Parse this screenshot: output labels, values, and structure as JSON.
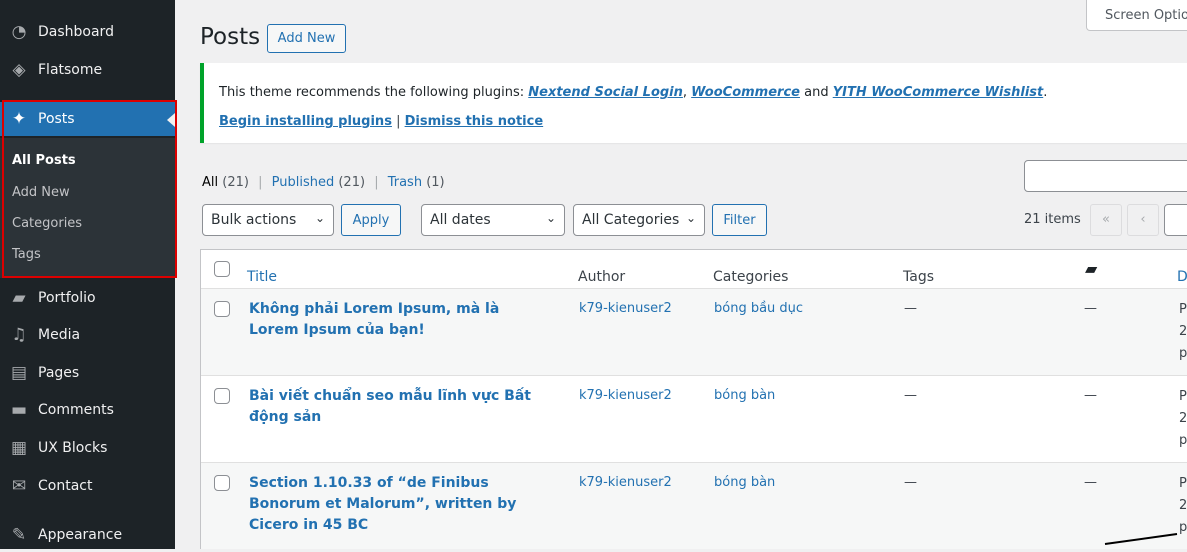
{
  "sidebar": {
    "items": [
      {
        "label": "Dashboard",
        "icon": "dashboard-icon",
        "glyph": "◔"
      },
      {
        "label": "Flatsome",
        "icon": "flatsome-icon",
        "glyph": "◈"
      },
      {
        "label": "Posts",
        "icon": "pin-icon",
        "glyph": "📌"
      },
      {
        "label": "Portfolio",
        "icon": "folder-icon",
        "glyph": "▰"
      },
      {
        "label": "Media",
        "icon": "media-icon",
        "glyph": "♫"
      },
      {
        "label": "Pages",
        "icon": "pages-icon",
        "glyph": "▤"
      },
      {
        "label": "Comments",
        "icon": "comment-icon",
        "glyph": "▬"
      },
      {
        "label": "UX Blocks",
        "icon": "blocks-icon",
        "glyph": "▦"
      },
      {
        "label": "Contact",
        "icon": "mail-icon",
        "glyph": "✉"
      },
      {
        "label": "Appearance",
        "icon": "brush-icon",
        "glyph": "✎"
      }
    ],
    "submenu": [
      "All Posts",
      "Add New",
      "Categories",
      "Tags"
    ]
  },
  "header": {
    "title": "Posts",
    "add_new": "Add New",
    "screen_options": "Screen Optio"
  },
  "notice": {
    "text": "This theme recommends the following plugins: ",
    "p1": "Nextend Social Login",
    "sep1": ", ",
    "p2": "WooCommerce",
    "and": " and ",
    "p3": "YITH WooCommerce Wishlist",
    "end": ".",
    "begin": "Begin installing plugins",
    "pipe": " | ",
    "dismiss": "Dismiss this notice",
    "accent": "#00a32a"
  },
  "filters": {
    "all": "All",
    "all_count": " (21)",
    "published": "Published",
    "published_count": " (21)",
    "trash": "Trash",
    "trash_count": " (1)",
    "sep": "|"
  },
  "toolbar": {
    "bulk": "Bulk actions",
    "apply": "Apply",
    "dates": "All dates",
    "cats": "All Categories",
    "filter": "Filter",
    "items": "21 items",
    "first": "«",
    "prev": "‹"
  },
  "table": {
    "headers": {
      "title": "Title",
      "author": "Author",
      "categories": "Categories",
      "tags": "Tags",
      "date": "D"
    },
    "rows": [
      {
        "title": "Không phải Lorem Ipsum, mà là Lorem Ipsum của bạn!",
        "author": "k79-kienuser2",
        "category": "bóng bầu dục",
        "tags": "—",
        "comments": "—",
        "date": [
          "P",
          "2",
          "p"
        ]
      },
      {
        "title": "Bài viết chuẩn seo mẫu lĩnh vực Bất động sản",
        "author": "k79-kienuser2",
        "category": "bóng bàn",
        "tags": "—",
        "comments": "—",
        "date": [
          "P",
          "2",
          "p"
        ]
      },
      {
        "title": "Section 1.10.33 of “de Finibus Bonorum et Malorum”, written by Cicero in 45 BC",
        "author": "k79-kienuser2",
        "category": "bóng bàn",
        "tags": "—",
        "comments": "—",
        "date": [
          "P",
          "2",
          "p"
        ]
      }
    ]
  }
}
